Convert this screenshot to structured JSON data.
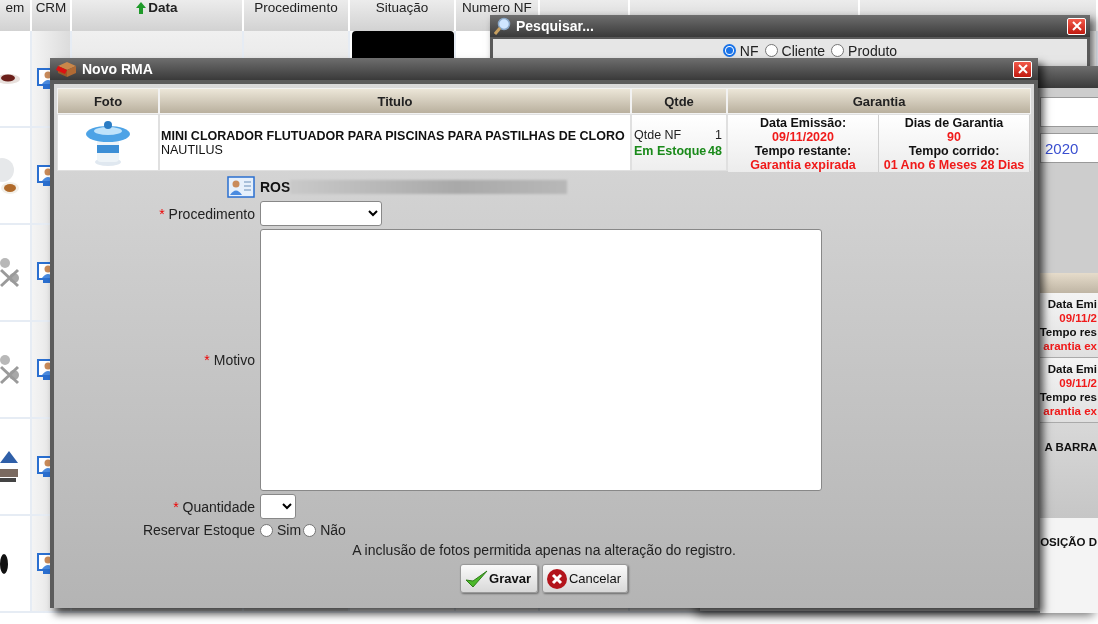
{
  "background_table": {
    "columns": [
      {
        "label": "em",
        "sorted": false
      },
      {
        "label": "CRM",
        "sorted": false
      },
      {
        "label": "Data",
        "sorted": true
      },
      {
        "label": "Procedimento",
        "sorted": false
      },
      {
        "label": "Situação",
        "sorted": false
      },
      {
        "label": "Numero NF",
        "sorted": false
      }
    ],
    "rows": [
      {
        "kind": "picture"
      },
      {
        "kind": "picture"
      },
      {
        "kind": "picture"
      },
      {
        "kind": "picture"
      },
      {
        "kind": "picture"
      },
      {
        "kind": "picture"
      }
    ]
  },
  "search_window": {
    "title": "Pesquisar...",
    "search_by": [
      {
        "label": "NF",
        "selected": true
      },
      {
        "label": "Cliente",
        "selected": false
      },
      {
        "label": "Produto",
        "selected": false
      }
    ]
  },
  "back_window": {
    "fields": [
      {
        "kind": "input"
      },
      {
        "kind": "input",
        "value": "2020"
      }
    ],
    "results": [
      {
        "lines": [
          {
            "text": "Data Emi",
            "kind": "label"
          },
          {
            "text": "09/11/2",
            "kind": "alert"
          },
          {
            "text": "Tempo res",
            "kind": "label"
          },
          {
            "text": "arantia ex",
            "kind": "alert"
          }
        ]
      },
      {
        "lines": [
          {
            "text": "Data Emi",
            "kind": "label"
          },
          {
            "text": "09/11/2",
            "kind": "alert"
          },
          {
            "text": "Tempo res",
            "kind": "label"
          },
          {
            "text": "arantia ex",
            "kind": "alert"
          }
        ]
      }
    ],
    "labels": [
      "A BARRA",
      "OSIÇÃO D"
    ]
  },
  "rma_window": {
    "title": "Novo RMA",
    "product_table": {
      "columns": [
        "Foto",
        "Titulo",
        "Qtde",
        "Garantia"
      ],
      "rows": [
        {
          "photo": {
            "kind": "picture"
          },
          "title": "MINI CLORADOR FLUTUADOR PARA PISCINAS PARA PASTILHAS DE CLORO",
          "brand": "NAUTILUS",
          "qty": [
            {
              "label": "Qtde NF",
              "value": "1",
              "kind": "normal"
            },
            {
              "label": "Em Estoque",
              "value": "48",
              "kind": "stock"
            }
          ],
          "warranty": [
            {
              "lines": [
                {
                  "text": "Data Emissão:",
                  "kind": "label"
                },
                {
                  "text": "09/11/2020",
                  "kind": "alert"
                },
                {
                  "text": "Tempo restante:",
                  "kind": "label"
                },
                {
                  "text": "Garantia expirada",
                  "kind": "alert"
                }
              ]
            },
            {
              "lines": [
                {
                  "text": "Dias de Garantia",
                  "kind": "label"
                },
                {
                  "text": "90",
                  "kind": "alert"
                },
                {
                  "text": "Tempo corrido:",
                  "kind": "label"
                },
                {
                  "text": "01 Ano 6 Meses 28 Dias",
                  "kind": "alert"
                }
              ]
            }
          ]
        }
      ]
    },
    "customer": {
      "name": "ROS",
      "redacted": true
    },
    "form": [
      {
        "kind": "select",
        "label": "Procedimento",
        "required_mark": "*"
      },
      {
        "kind": "textarea",
        "label": "Motivo",
        "required_mark": "*"
      },
      {
        "kind": "small-select",
        "label": "Quantidade",
        "required_mark": "*"
      },
      {
        "kind": "radios",
        "label": "Reservar Estoque",
        "options": [
          {
            "label": "Sim",
            "selected": false
          },
          {
            "label": "Não",
            "selected": false
          }
        ]
      }
    ],
    "note": "A inclusão de fotos permitida apenas na alteração do registro.",
    "buttons": [
      {
        "label": "Gravar",
        "kind": "save"
      },
      {
        "label": "Cancelar",
        "kind": "cancel"
      }
    ]
  }
}
